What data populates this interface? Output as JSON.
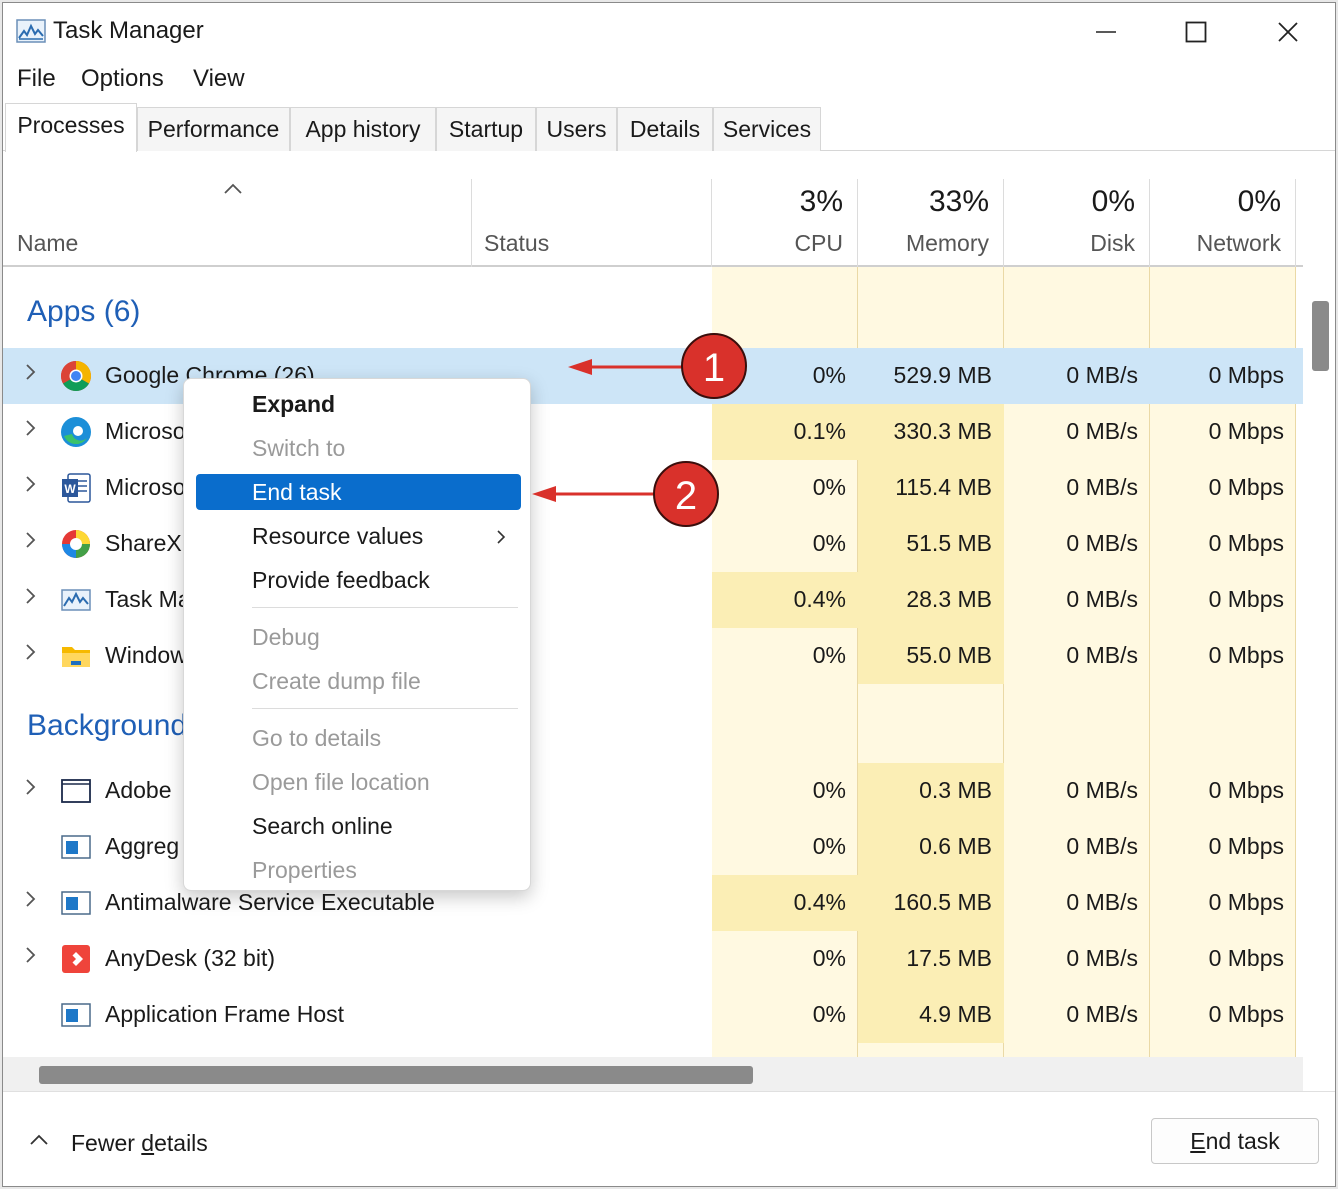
{
  "window": {
    "title": "Task Manager"
  },
  "menu": [
    "File",
    "Options",
    "View"
  ],
  "tabs": [
    "Processes",
    "Performance",
    "App history",
    "Startup",
    "Users",
    "Details",
    "Services"
  ],
  "columns": {
    "name": "Name",
    "status": "Status",
    "cpu": {
      "pct": "3%",
      "label": "CPU"
    },
    "memory": {
      "pct": "33%",
      "label": "Memory"
    },
    "disk": {
      "pct": "0%",
      "label": "Disk"
    },
    "network": {
      "pct": "0%",
      "label": "Network"
    }
  },
  "groups": {
    "apps": "Apps (6)",
    "background": "Background"
  },
  "apps": [
    {
      "name": "Google Chrome (26)",
      "cpu": "0%",
      "memory": "529.9 MB",
      "disk": "0 MB/s",
      "network": "0 Mbps"
    },
    {
      "name": "Microso",
      "cpu": "0.1%",
      "memory": "330.3 MB",
      "disk": "0 MB/s",
      "network": "0 Mbps"
    },
    {
      "name": "Microso",
      "cpu": "0%",
      "memory": "115.4 MB",
      "disk": "0 MB/s",
      "network": "0 Mbps"
    },
    {
      "name": "ShareX",
      "cpu": "0%",
      "memory": "51.5 MB",
      "disk": "0 MB/s",
      "network": "0 Mbps"
    },
    {
      "name": "Task Ma",
      "cpu": "0.4%",
      "memory": "28.3 MB",
      "disk": "0 MB/s",
      "network": "0 Mbps"
    },
    {
      "name": "Window",
      "cpu": "0%",
      "memory": "55.0 MB",
      "disk": "0 MB/s",
      "network": "0 Mbps"
    }
  ],
  "background": [
    {
      "name": "Adobe",
      "cpu": "0%",
      "memory": "0.3 MB",
      "disk": "0 MB/s",
      "network": "0 Mbps"
    },
    {
      "name": "Aggreg",
      "cpu": "0%",
      "memory": "0.6 MB",
      "disk": "0 MB/s",
      "network": "0 Mbps"
    },
    {
      "name": "Antimalware Service Executable",
      "cpu": "0.4%",
      "memory": "160.5 MB",
      "disk": "0 MB/s",
      "network": "0 Mbps"
    },
    {
      "name": "AnyDesk (32 bit)",
      "cpu": "0%",
      "memory": "17.5 MB",
      "disk": "0 MB/s",
      "network": "0 Mbps"
    },
    {
      "name": "Application Frame Host",
      "cpu": "0%",
      "memory": "4.9 MB",
      "disk": "0 MB/s",
      "network": "0 Mbps"
    }
  ],
  "context_menu": {
    "expand": "Expand",
    "switch_to": "Switch to",
    "end_task": "End task",
    "resource_values": "Resource values",
    "provide_feedback": "Provide feedback",
    "debug": "Debug",
    "create_dump_file": "Create dump file",
    "go_to_details": "Go to details",
    "open_file_location": "Open file location",
    "search_online": "Search online",
    "properties": "Properties"
  },
  "annotations": {
    "marker1": "1",
    "marker2": "2"
  },
  "footer": {
    "fewer_details_prefix": "Fewer ",
    "fewer_details_key": "d",
    "fewer_details_suffix": "etails",
    "end_task_key": "E",
    "end_task_rest": "nd task"
  },
  "colors": {
    "accent": "#0a6dcc",
    "group_heading": "#1f5fb6",
    "heat_light": "#fff9e1",
    "heat_medium": "#fbeeb5",
    "selection": "#cde5f7",
    "annotation_red": "#d9312b"
  }
}
